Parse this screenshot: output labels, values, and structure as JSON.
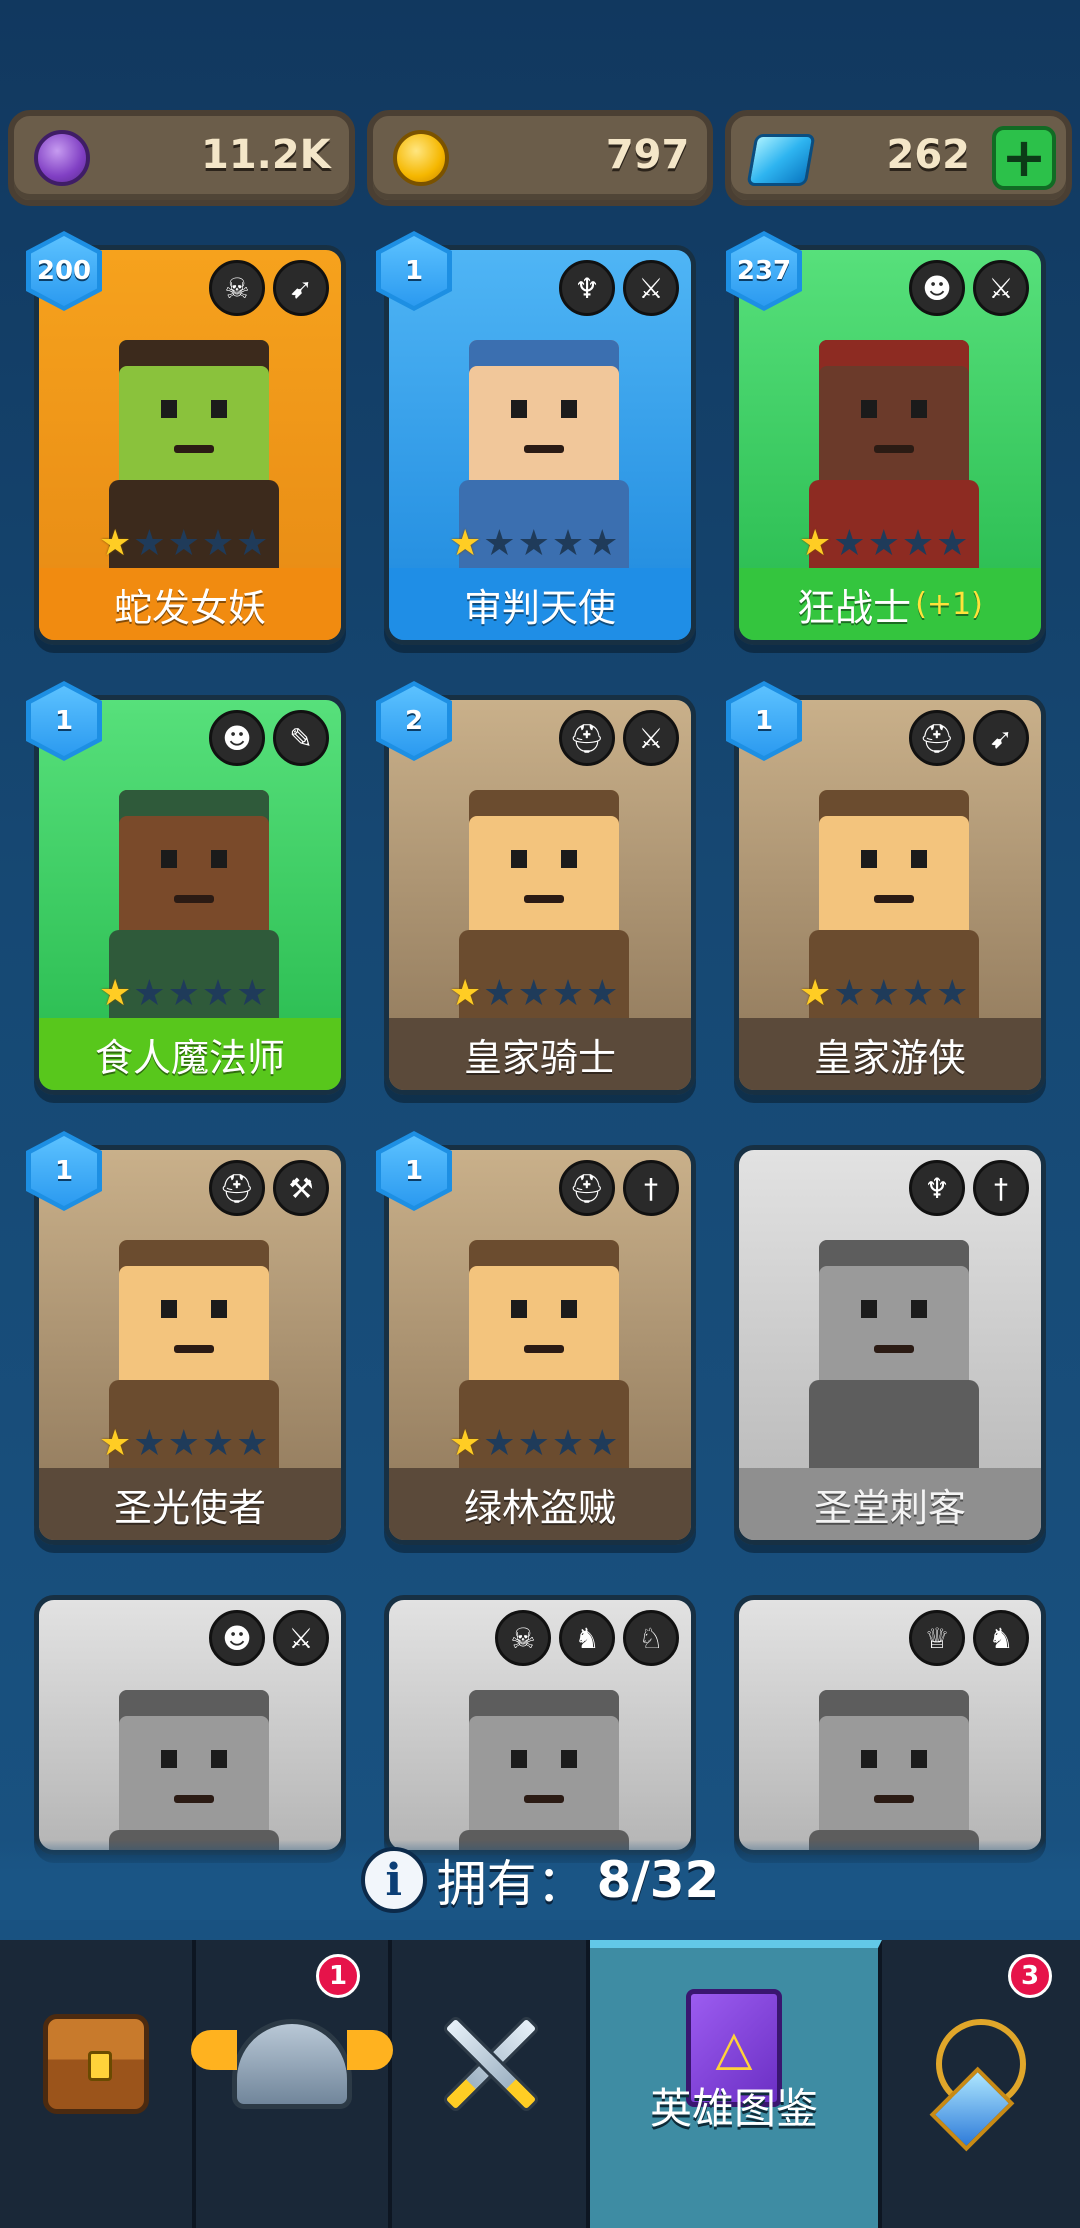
{
  "currencies": {
    "elixir": {
      "value": "11.2K",
      "icon": "elixir-coin-icon"
    },
    "gold": {
      "value": "797",
      "icon": "gold-coin-icon"
    },
    "gems": {
      "value": "262",
      "icon": "diamond-icon",
      "add_label": "+"
    }
  },
  "heroes": [
    {
      "name": "蛇发女妖",
      "level": "200",
      "stars": 1,
      "rarity": "orange",
      "class_icons": [
        "horned-skull-icon",
        "bow-icon"
      ]
    },
    {
      "name": "审判天使",
      "level": "1",
      "stars": 1,
      "rarity": "blue",
      "class_icons": [
        "winged-emblem-icon",
        "sword-icon"
      ]
    },
    {
      "name": "狂战士",
      "bonus": "(+1)",
      "level": "237",
      "stars": 1,
      "rarity": "green",
      "class_icons": [
        "orc-face-icon",
        "sword-icon"
      ]
    },
    {
      "name": "食人魔法师",
      "level": "1",
      "stars": 1,
      "rarity": "lime",
      "class_icons": [
        "orc-face-icon",
        "staff-icon"
      ]
    },
    {
      "name": "皇家骑士",
      "level": "2",
      "stars": 1,
      "rarity": "brown",
      "class_icons": [
        "knight-helmet-icon",
        "sword-icon"
      ]
    },
    {
      "name": "皇家游侠",
      "level": "1",
      "stars": 1,
      "rarity": "brown",
      "class_icons": [
        "knight-helmet-icon",
        "bow-icon"
      ]
    },
    {
      "name": "圣光使者",
      "level": "1",
      "stars": 1,
      "rarity": "brown",
      "class_icons": [
        "knight-helmet-icon",
        "hammer-icon"
      ]
    },
    {
      "name": "绿林盗贼",
      "level": "1",
      "stars": 1,
      "rarity": "brown",
      "class_icons": [
        "knight-helmet-icon",
        "dagger-icon"
      ]
    },
    {
      "name": "圣堂刺客",
      "level": "",
      "stars": 0,
      "rarity": "locked",
      "class_icons": [
        "winged-emblem-icon",
        "dagger-icon"
      ]
    },
    {
      "name": "",
      "level": "",
      "stars": 0,
      "rarity": "locked",
      "class_icons": [
        "orc-face-icon",
        "sword-icon"
      ]
    },
    {
      "name": "",
      "level": "",
      "stars": 0,
      "rarity": "locked",
      "class_icons": [
        "horned-skull-icon",
        "dragon-icon",
        "dragon-head-icon"
      ]
    },
    {
      "name": "",
      "level": "",
      "stars": 0,
      "rarity": "locked",
      "class_icons": [
        "elf-icon",
        "dragon-icon"
      ]
    }
  ],
  "owned": {
    "label": "拥有：",
    "value": "8/32"
  },
  "nav": [
    {
      "id": "shop",
      "icon": "treasure-chest-icon",
      "badge": ""
    },
    {
      "id": "heroes",
      "icon": "winged-helmet-icon",
      "badge": "1"
    },
    {
      "id": "battle",
      "icon": "crossed-swords-icon",
      "badge": ""
    },
    {
      "id": "codex",
      "icon": "spellbook-icon",
      "label": "英雄图鉴",
      "badge": "",
      "active": true
    },
    {
      "id": "equipment",
      "icon": "amulet-icon",
      "badge": "3"
    }
  ],
  "colors": {
    "accent_blue": "#1d8fe3",
    "active_tab": "#3e8ca3",
    "badge_red": "#e6134a",
    "star_gold": "#ffcd24"
  }
}
